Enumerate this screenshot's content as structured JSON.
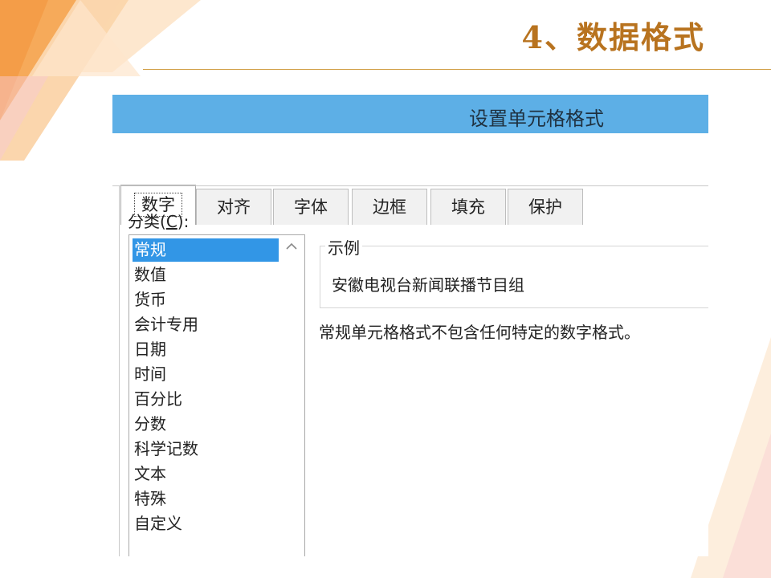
{
  "slide": {
    "title": "4、数据格式"
  },
  "dialog": {
    "title": "设置单元格格式",
    "tabs": [
      {
        "label": "数字",
        "active": true
      },
      {
        "label": "对齐",
        "active": false
      },
      {
        "label": "字体",
        "active": false
      },
      {
        "label": "边框",
        "active": false
      },
      {
        "label": "填充",
        "active": false
      },
      {
        "label": "保护",
        "active": false
      }
    ],
    "category_label": "分类(",
    "category_hotkey": "C",
    "category_label_end": "):",
    "categories": [
      "常规",
      "数值",
      "货币",
      "会计专用",
      "日期",
      "时间",
      "百分比",
      "分数",
      "科学记数",
      "文本",
      "特殊",
      "自定义"
    ],
    "selected_category": "常规",
    "sample_legend": "示例",
    "sample_value": "安徽电视台新闻联播节目组",
    "description": "常规单元格格式不包含任何特定的数字格式。"
  },
  "colors": {
    "title": "#b8731f",
    "titlebar": "#5dafe6",
    "selection": "#3296e6",
    "deco_orange": "#f28c28"
  },
  "icons": {
    "scroll_up": "chevron-up-icon"
  }
}
